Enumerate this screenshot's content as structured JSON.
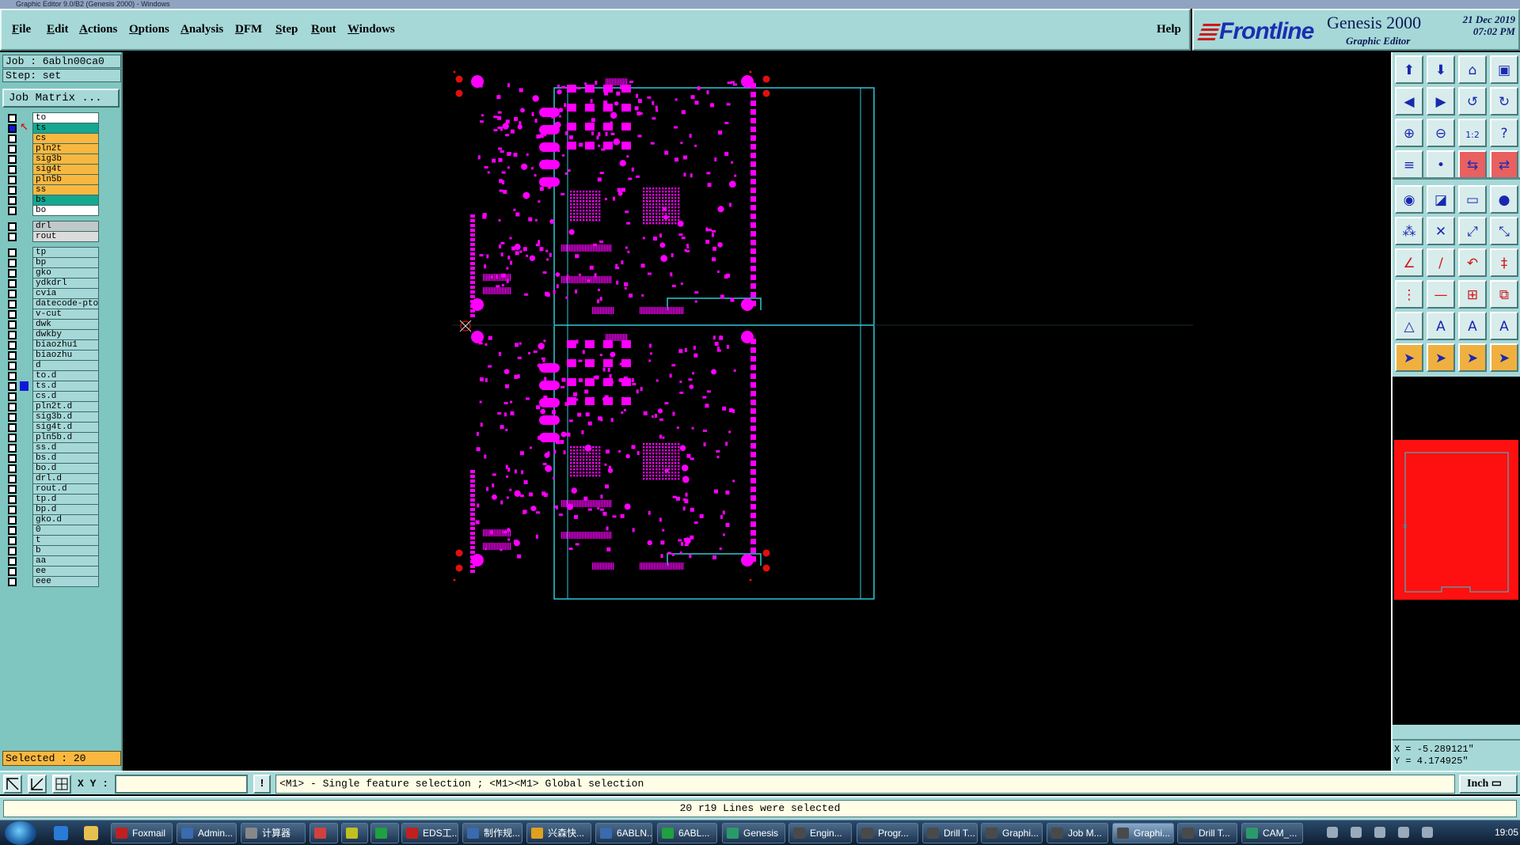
{
  "window_title": "Graphic Editor 9.0/B2 (Genesis 2000) - Windows",
  "menu": [
    "File",
    "Edit",
    "Actions",
    "Options",
    "Analysis",
    "DFM",
    "Step",
    "Rout",
    "Windows"
  ],
  "help": "Help",
  "brand": {
    "logo": "Frontline",
    "product": "Genesis 2000",
    "subtitle": "Graphic Editor",
    "date": "21 Dec 2019",
    "time": "07:02 PM"
  },
  "job": "Job : 6abln00ca0",
  "step": "Step: set",
  "job_matrix_label": "Job Matrix ...",
  "layers": [
    {
      "name": "to",
      "color": "#ffffff",
      "checked": false,
      "mark": ""
    },
    {
      "name": "ts",
      "color": "#14a890",
      "checked": true,
      "mark": "arrow"
    },
    {
      "name": "cs",
      "color": "#f8b840",
      "checked": false,
      "mark": ""
    },
    {
      "name": "pln2t",
      "color": "#f8b840",
      "checked": false,
      "mark": ""
    },
    {
      "name": "sig3b",
      "color": "#f8b840",
      "checked": false,
      "mark": ""
    },
    {
      "name": "sig4t",
      "color": "#f8b840",
      "checked": false,
      "mark": ""
    },
    {
      "name": "pln5b",
      "color": "#f8b840",
      "checked": false,
      "mark": ""
    },
    {
      "name": "ss",
      "color": "#f8b840",
      "checked": false,
      "mark": ""
    },
    {
      "name": "bs",
      "color": "#14a890",
      "checked": false,
      "mark": ""
    },
    {
      "name": "bo",
      "color": "#ffffff",
      "checked": false,
      "mark": ""
    },
    {
      "name": "drl",
      "color": "#c0c8c8",
      "checked": false,
      "mark": "",
      "gap": true
    },
    {
      "name": "rout",
      "color": "#dcdcdc",
      "checked": false,
      "mark": ""
    },
    {
      "name": "tp",
      "color": "#a6d8d8",
      "checked": false,
      "mark": "",
      "gap": true
    },
    {
      "name": "bp",
      "color": "#a6d8d8",
      "checked": false,
      "mark": ""
    },
    {
      "name": "gko",
      "color": "#a6d8d8",
      "checked": false,
      "mark": ""
    },
    {
      "name": "ydkdrl",
      "color": "#a6d8d8",
      "checked": false,
      "mark": ""
    },
    {
      "name": "cvia",
      "color": "#a6d8d8",
      "checked": false,
      "mark": ""
    },
    {
      "name": "datecode-pto",
      "color": "#a6d8d8",
      "checked": false,
      "mark": ""
    },
    {
      "name": "v-cut",
      "color": "#a6d8d8",
      "checked": false,
      "mark": ""
    },
    {
      "name": "dwk",
      "color": "#a6d8d8",
      "checked": false,
      "mark": ""
    },
    {
      "name": "dwkby",
      "color": "#a6d8d8",
      "checked": false,
      "mark": ""
    },
    {
      "name": "biaozhu1",
      "color": "#a6d8d8",
      "checked": false,
      "mark": ""
    },
    {
      "name": "biaozhu",
      "color": "#a6d8d8",
      "checked": false,
      "mark": ""
    },
    {
      "name": "d",
      "color": "#a6d8d8",
      "checked": false,
      "mark": ""
    },
    {
      "name": "to.d",
      "color": "#a6d8d8",
      "checked": false,
      "mark": ""
    },
    {
      "name": "ts.d",
      "color": "#a6d8d8",
      "checked": false,
      "mark": "blue"
    },
    {
      "name": "cs.d",
      "color": "#a6d8d8",
      "checked": false,
      "mark": ""
    },
    {
      "name": "pln2t.d",
      "color": "#a6d8d8",
      "checked": false,
      "mark": ""
    },
    {
      "name": "sig3b.d",
      "color": "#a6d8d8",
      "checked": false,
      "mark": ""
    },
    {
      "name": "sig4t.d",
      "color": "#a6d8d8",
      "checked": false,
      "mark": ""
    },
    {
      "name": "pln5b.d",
      "color": "#a6d8d8",
      "checked": false,
      "mark": ""
    },
    {
      "name": "ss.d",
      "color": "#a6d8d8",
      "checked": false,
      "mark": ""
    },
    {
      "name": "bs.d",
      "color": "#a6d8d8",
      "checked": false,
      "mark": ""
    },
    {
      "name": "bo.d",
      "color": "#a6d8d8",
      "checked": false,
      "mark": ""
    },
    {
      "name": "drl.d",
      "color": "#a6d8d8",
      "checked": false,
      "mark": ""
    },
    {
      "name": "rout.d",
      "color": "#a6d8d8",
      "checked": false,
      "mark": ""
    },
    {
      "name": "tp.d",
      "color": "#a6d8d8",
      "checked": false,
      "mark": ""
    },
    {
      "name": "bp.d",
      "color": "#a6d8d8",
      "checked": false,
      "mark": ""
    },
    {
      "name": "gko.d",
      "color": "#a6d8d8",
      "checked": false,
      "mark": ""
    },
    {
      "name": "0",
      "color": "#a6d8d8",
      "checked": false,
      "mark": ""
    },
    {
      "name": "t",
      "color": "#a6d8d8",
      "checked": false,
      "mark": ""
    },
    {
      "name": "b",
      "color": "#a6d8d8",
      "checked": false,
      "mark": ""
    },
    {
      "name": "aa",
      "color": "#a6d8d8",
      "checked": false,
      "mark": ""
    },
    {
      "name": "ee",
      "color": "#a6d8d8",
      "checked": false,
      "mark": ""
    },
    {
      "name": "eee",
      "color": "#a6d8d8",
      "checked": false,
      "mark": ""
    }
  ],
  "selected": "Selected : 20",
  "coords": {
    "x": "X = -5.289121\"",
    "y": "Y = 4.174925\""
  },
  "xy_label": "X Y :",
  "message": "<M1> - Single feature selection ; <M1><M1> Global selection",
  "unit": "Inch",
  "status": "20 r19 Lines were selected",
  "colors": {
    "feature": "#ff00ff",
    "profile": "#2ec8d8",
    "drill": "#e01010",
    "layer_thumb": "#ff1010"
  },
  "tools": [
    "zoom-home-icon",
    "zoom-fit-icon",
    "home-icon",
    "window-icon",
    "pan-left-icon",
    "pan-right-icon",
    "undo-zoom-icon",
    "redraw-icon",
    "zoom-in-icon",
    "zoom-out-icon",
    "ratio-icon",
    "query-icon",
    "measure-icon",
    "snap-icon",
    "layer-compare-icon",
    "layer-swap-icon",
    "pad-add-icon",
    "surface-icon",
    "line-icon",
    "fill-icon",
    "select-icon",
    "cross-icon",
    "move-icon",
    "copy-icon",
    "angle-icon",
    "slash-icon",
    "rotate-icon",
    "mirror-icon",
    "split-icon",
    "minus-icon",
    "resize-icon",
    "group-icon",
    "triangle-icon",
    "letter-a-icon",
    "letter-a2-icon",
    "letter-a3-icon",
    "pointer-icon",
    "pointer2-icon",
    "pointer3-icon",
    "pointer4-icon"
  ],
  "taskbar": {
    "tasks": [
      "Foxmail",
      "Admin...",
      "计算器",
      "",
      "",
      "",
      "EDS工...",
      "制作规...",
      "兴森快...",
      "6ABLN...",
      "6ABL...",
      "Genesis",
      "Engin...",
      "Progr...",
      "Drill T...",
      "Graphi...",
      "Job M...",
      "Graphi...",
      "Drill T...",
      "CAM_..."
    ],
    "clock": "19:05"
  }
}
